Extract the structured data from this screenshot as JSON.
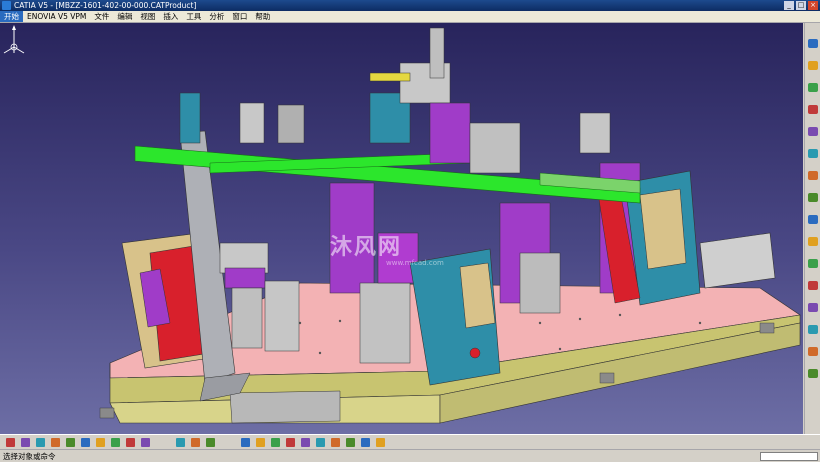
{
  "window": {
    "title": "CATIA V5 - [MBZZ-1601-402-00-000.CATProduct]"
  },
  "menu": {
    "items": [
      "开始",
      "ENOVIA V5 VPM",
      "文件",
      "编辑",
      "视图",
      "插入",
      "工具",
      "分析",
      "窗口",
      "帮助"
    ]
  },
  "statusbar": {
    "prompt": "选择对象或命令"
  },
  "watermark": {
    "brand": "沐风网",
    "url": "www.mfcad.com"
  },
  "colors": {
    "bg_top": "#28245c",
    "bg_bottom": "#6d6ea5",
    "plate": "#f0a0a8",
    "frame": "#d8d48a",
    "beam": "#2ce62c",
    "magenta": "#a03cc8",
    "teal": "#2e8ea8",
    "red": "#d8202c"
  },
  "icons": {
    "right_toolbar": [
      "arrow-icon",
      "zoom-icon",
      "view-icon",
      "product-icon",
      "constraint-icon",
      "assembly-icon",
      "move-icon",
      "explode-icon",
      "clash-icon",
      "section-icon",
      "measure-icon",
      "annotation-icon",
      "scene-icon",
      "bulb-icon",
      "catalog-icon",
      "material-icon"
    ],
    "bottom_toolbar": [
      "new-icon",
      "open-icon",
      "save-icon",
      "print-icon",
      "cut-icon",
      "copy-icon",
      "paste-icon",
      "undo-icon",
      "redo-icon",
      "help-icon",
      "formula-icon",
      "knowledge-icon",
      "measure-icon",
      "fit-icon",
      "pan-icon",
      "rotate-icon",
      "zoom-in-icon",
      "zoom-out-icon",
      "normal-view-icon",
      "iso-view-icon",
      "shading-icon",
      "hide-show-icon",
      "swap-icon"
    ]
  }
}
